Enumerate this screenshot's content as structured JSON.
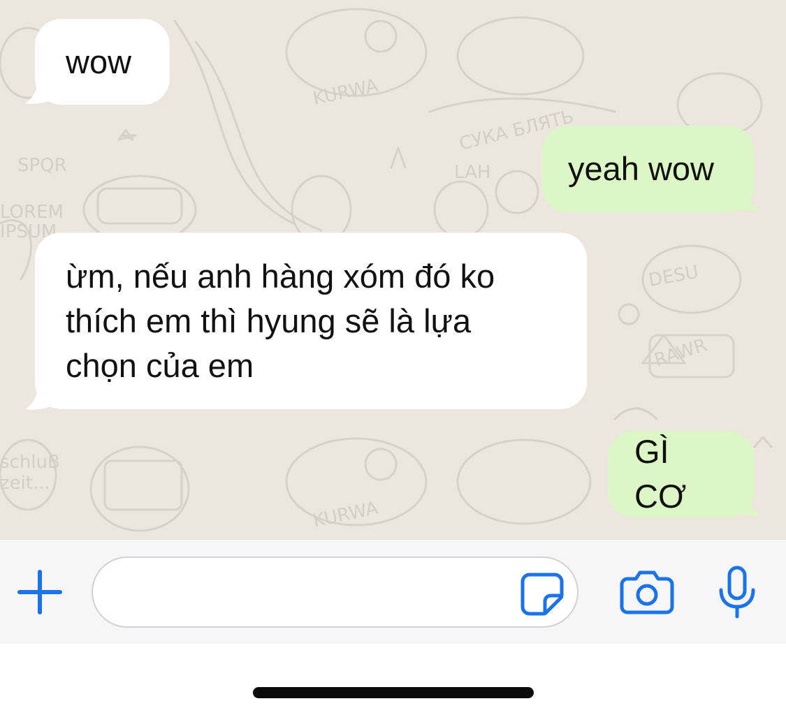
{
  "chat": {
    "messages": [
      {
        "direction": "incoming",
        "text": "wow"
      },
      {
        "direction": "outgoing",
        "text": "yeah wow"
      },
      {
        "direction": "incoming",
        "text": "ừm, nếu anh hàng xóm đó ko\nthích em thì hyung sẽ là lựa\nchọn của em"
      },
      {
        "direction": "outgoing",
        "text": "GÌ CƠ"
      }
    ],
    "doodle_words": [
      "KURWA",
      "СУКА БЛЯТЬ",
      "DESU",
      "RAWR",
      "SPQR",
      "LOREM IPSUM",
      "LAH",
      "schluB zeit..."
    ]
  },
  "composer": {
    "input_value": "",
    "icons": {
      "add": "plus-icon",
      "sticker": "sticker-icon",
      "camera": "camera-icon",
      "mic": "microphone-icon"
    }
  },
  "colors": {
    "chat_background": "#ece6df",
    "incoming_bubble": "#ffffff",
    "outgoing_bubble": "#dcf6c6",
    "accent": "#1a73e8",
    "composer_bg": "#f6f6f7"
  }
}
